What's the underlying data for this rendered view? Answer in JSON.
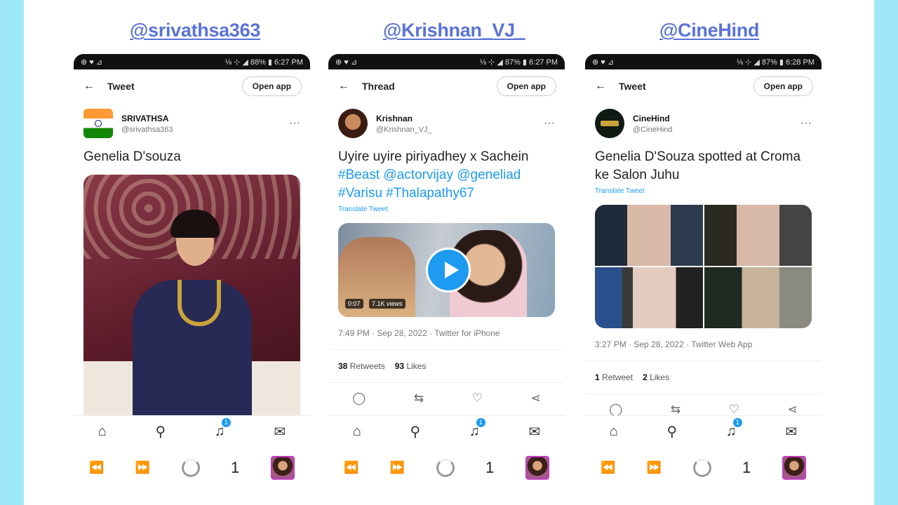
{
  "handles": [
    "@srivathsa363",
    "@Krishnan_VJ_",
    "@CineHind"
  ],
  "phones": [
    {
      "status": {
        "left": "⊕ ♥ ⊿",
        "right": "⅛ ⊹ ◢ 88% ▮ 6:27 PM"
      },
      "header_title": "Tweet",
      "open_app": "Open app",
      "display_name": "SRIVATHSA",
      "username": "@srivathsa363",
      "text": "Genelia D'souza"
    },
    {
      "status": {
        "left": "⊕ ♥ ⊿",
        "right": "⅛ ⊹ ◢ 87% ▮ 6:27 PM"
      },
      "header_title": "Thread",
      "open_app": "Open app",
      "display_name": "Krishnan",
      "username": "@Krishnan_VJ_",
      "text_plain": "Uyire uyire piriyadhey x Sachein",
      "hashtags": "#Beast @actorvijay @geneliad #Varisu #Thalapathy67",
      "translate": "Translate Tweet",
      "video_duration": "0:07",
      "video_views": "7.1K views",
      "meta": "7:49 PM · Sep 28, 2022 · Twitter for iPhone",
      "retweets": "38",
      "retweets_label": "Retweets",
      "likes": "93",
      "likes_label": "Likes"
    },
    {
      "status": {
        "left": "⊕ ♥ ⊿",
        "right": "⅛ ⊹ ◢ 87% ▮ 6:28 PM"
      },
      "header_title": "Tweet",
      "open_app": "Open app",
      "display_name": "CineHind",
      "username": "@CineHind",
      "text": "Genelia D'Souza spotted at Croma ke Salon Juhu",
      "translate": "Translate Tweet",
      "meta": "3:27 PM · Sep 28, 2022 · Twitter Web App",
      "retweets": "1",
      "retweets_label": "Retweet",
      "likes": "2",
      "likes_label": "Likes"
    }
  ],
  "nav": {
    "badge": "1"
  },
  "browser": {
    "tab_count": "1"
  },
  "colors": {
    "link": "#1d9bf0",
    "handle": "#5b73d6",
    "frame": "#9fe8f7"
  }
}
